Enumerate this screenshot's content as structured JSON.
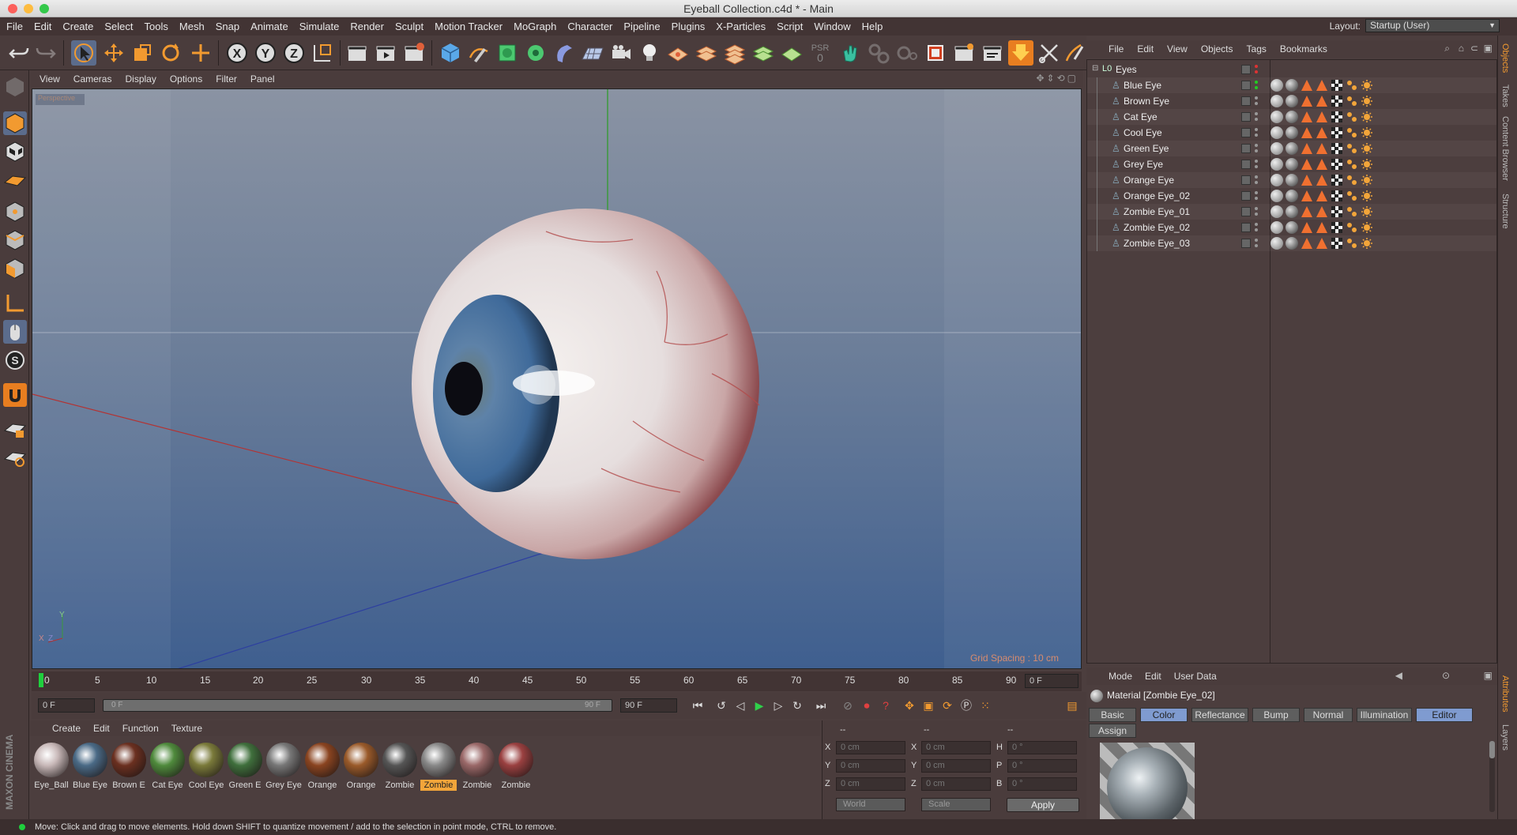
{
  "window": {
    "title": "Eyeball Collection.c4d * - Main"
  },
  "menubar": [
    "File",
    "Edit",
    "Create",
    "Select",
    "Tools",
    "Mesh",
    "Snap",
    "Animate",
    "Simulate",
    "Render",
    "Sculpt",
    "Motion Tracker",
    "MoGraph",
    "Character",
    "Pipeline",
    "Plugins",
    "X-Particles",
    "Script",
    "Window",
    "Help"
  ],
  "layout": {
    "label": "Layout:",
    "value": "Startup (User)"
  },
  "viewport": {
    "menu": [
      "View",
      "Cameras",
      "Display",
      "Options",
      "Filter",
      "Panel"
    ],
    "camera": "Perspective",
    "grid_spacing": "Grid Spacing : 10 cm",
    "axis_y": "Y",
    "axis_x": "X",
    "axis_z": "Z"
  },
  "timeline": {
    "ticks": [
      "0",
      "5",
      "10",
      "15",
      "20",
      "25",
      "30",
      "35",
      "40",
      "45",
      "50",
      "55",
      "60",
      "65",
      "70",
      "75",
      "80",
      "85",
      "90"
    ],
    "current_frame": "0 F"
  },
  "transport": {
    "start": "0 F",
    "range_start": "0 F",
    "range_end": "90 F",
    "end": "90 F"
  },
  "materials": {
    "menu": [
      "Create",
      "Edit",
      "Function",
      "Texture"
    ],
    "items": [
      {
        "label": "Eye_Ball",
        "color": "#c8b8b8"
      },
      {
        "label": "Blue Eye",
        "color": "#4a6a86"
      },
      {
        "label": "Brown E",
        "color": "#6b3020"
      },
      {
        "label": "Cat Eye",
        "color": "#4f8a3c"
      },
      {
        "label": "Cool Eye",
        "color": "#7a7a3a"
      },
      {
        "label": "Green E",
        "color": "#3f6f3c"
      },
      {
        "label": "Grey Eye",
        "color": "#777777"
      },
      {
        "label": "Orange",
        "color": "#8a4420"
      },
      {
        "label": "Orange",
        "color": "#9a5a2a"
      },
      {
        "label": "Zombie",
        "color": "#555555"
      },
      {
        "label": "Zombie",
        "color": "#888888"
      },
      {
        "label": "Zombie",
        "color": "#9a6868"
      },
      {
        "label": "Zombie",
        "color": "#9a4040"
      }
    ],
    "selected_index": 10
  },
  "coords": {
    "header": [
      "--",
      "--",
      "--"
    ],
    "rows": [
      {
        "a": "X",
        "av": "0 cm",
        "b": "X",
        "bv": "0 cm",
        "c": "H",
        "cv": "0 °"
      },
      {
        "a": "Y",
        "av": "0 cm",
        "b": "Y",
        "bv": "0 cm",
        "c": "P",
        "cv": "0 °"
      },
      {
        "a": "Z",
        "av": "0 cm",
        "b": "Z",
        "bv": "0 cm",
        "c": "B",
        "cv": "0 °"
      }
    ],
    "space": "World",
    "mode": "Scale",
    "apply": "Apply"
  },
  "objects": {
    "menu": [
      "File",
      "Edit",
      "View",
      "Objects",
      "Tags",
      "Bookmarks"
    ],
    "root": "Eyes",
    "children": [
      "Blue Eye",
      "Brown Eye",
      "Cat Eye",
      "Cool Eye",
      "Green Eye",
      "Grey Eye",
      "Orange Eye",
      "Orange Eye_02",
      "Zombie Eye_01",
      "Zombie Eye_02",
      "Zombie Eye_03"
    ]
  },
  "attributes": {
    "menu": [
      "Mode",
      "Edit",
      "User Data"
    ],
    "title": "Material [Zombie Eye_02]",
    "tabs": [
      "Basic",
      "Color",
      "Reflectance",
      "Bump",
      "Normal",
      "Illumination",
      "Editor"
    ],
    "assign": "Assign",
    "active_tabs": [
      1,
      6
    ]
  },
  "sidetabs": [
    "Objects",
    "Takes",
    "Content Browser",
    "Structure",
    "Attributes",
    "Layers"
  ],
  "brand": "MAXON CINEMA 4D",
  "status": "Move: Click and drag to move elements. Hold down SHIFT to quantize movement / add to the selection in point mode, CTRL to remove."
}
